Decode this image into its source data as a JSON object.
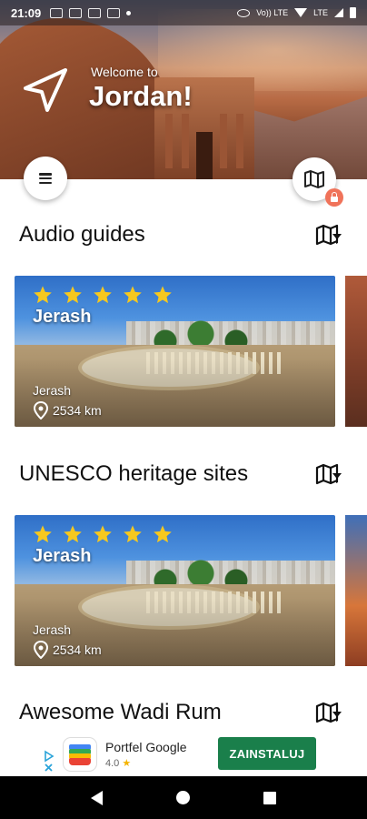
{
  "status_bar": {
    "time": "21:09",
    "network_label": "Vo)) LTE",
    "lte_label": "LTE"
  },
  "hero": {
    "welcome": "Welcome to",
    "country": "Jordan!"
  },
  "sections": [
    {
      "title": "Audio guides",
      "card": {
        "title": "Jerash",
        "subtitle": "Jerash",
        "distance": "2534 km",
        "rating": 5
      }
    },
    {
      "title": "UNESCO heritage sites",
      "card": {
        "title": "Jerash",
        "subtitle": "Jerash",
        "distance": "2534 km",
        "rating": 5
      }
    },
    {
      "title": "Awesome Wadi Rum"
    }
  ],
  "ad": {
    "app_name": "Portfel Google",
    "rating": "4.0",
    "install_label": "ZAINSTALUJ"
  },
  "icons": {
    "menu": "hamburger-menu-icon",
    "map": "map-icon",
    "lock": "lock-icon",
    "section_map": "map-filter-icon",
    "star": "star-icon",
    "pin": "location-pin-icon",
    "navigation": "navigation-arrow-icon"
  },
  "colors": {
    "star": "#f6c81e",
    "lock_badge": "#f0735a",
    "install_button": "#1a7f4b"
  }
}
